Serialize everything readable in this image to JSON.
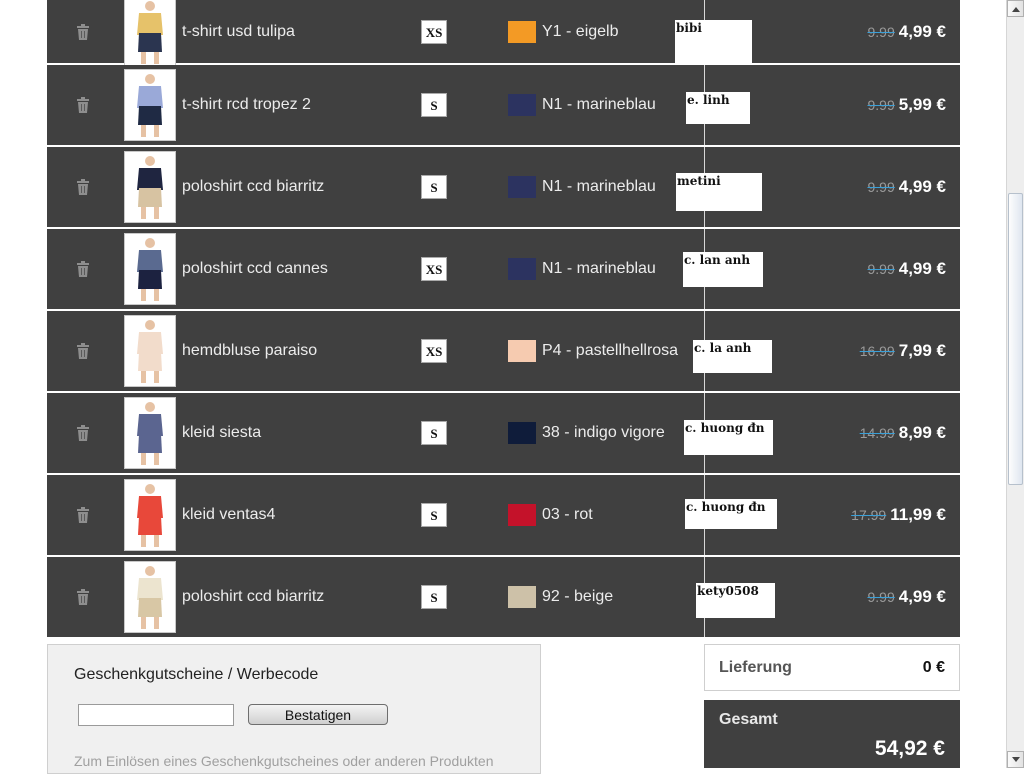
{
  "cart": {
    "items": [
      {
        "name": "t-shirt usd tulipa",
        "size": "XS",
        "color_name": "Y1 - eigelb",
        "color_hex": "#f39a25",
        "note": "bibi",
        "old_price": "9.99",
        "price": "4,99 €",
        "garment_colors": [
          "#e6c26a",
          "#2b3550"
        ]
      },
      {
        "name": "t-shirt rcd tropez 2",
        "size": "S",
        "color_name": "N1 - marineblau",
        "color_hex": "#2c3360",
        "note": "e. linh",
        "old_price": "9.99",
        "price": "5,99 €",
        "garment_colors": [
          "#9aa9d8",
          "#1f2a44"
        ]
      },
      {
        "name": "poloshirt ccd biarritz",
        "size": "S",
        "color_name": "N1 - marineblau",
        "color_hex": "#2c3360",
        "note": "metini",
        "old_price": "9.99",
        "price": "4,99 €",
        "garment_colors": [
          "#1f2540",
          "#d7c3a2"
        ]
      },
      {
        "name": "poloshirt ccd cannes",
        "size": "XS",
        "color_name": "N1 - marineblau",
        "color_hex": "#2c3360",
        "note": "c. lan anh",
        "old_price": "9.99",
        "price": "4,99 €",
        "garment_colors": [
          "#5a6a90",
          "#1c2240"
        ]
      },
      {
        "name": "hemdbluse paraiso",
        "size": "XS",
        "color_name": "P4 - pastellhellrosa",
        "color_hex": "#f6cbb0",
        "note": "c. la anh",
        "old_price": "16.99",
        "price": "7,99 €",
        "garment_colors": [
          "#f2dccb",
          "#f2dccb"
        ]
      },
      {
        "name": "kleid siesta",
        "size": "S",
        "color_name": "38 - indigo vigore",
        "color_hex": "#0f1c3a",
        "note": "c. huong đn",
        "old_price": "14.99",
        "price": "8,99 €",
        "garment_colors": [
          "#5b6590",
          "#5b6590"
        ]
      },
      {
        "name": "kleid ventas4",
        "size": "S",
        "color_name": "03 - rot",
        "color_hex": "#c4122a",
        "note": "c. huong đn",
        "old_price": "17.99",
        "price": "11,99 €",
        "garment_colors": [
          "#e8483a",
          "#e8483a"
        ]
      },
      {
        "name": "poloshirt ccd biarritz",
        "size": "S",
        "color_name": "92 - beige",
        "color_hex": "#cdc1a8",
        "note": "kety0508",
        "old_price": "9.99",
        "price": "4,99 €",
        "garment_colors": [
          "#ece4cf",
          "#d8c7a5"
        ]
      }
    ]
  },
  "voucher": {
    "title": "Geschenkgutscheine / Werbecode",
    "input_value": "",
    "button_label": "Bestatigen",
    "hint": "Zum Einlösen eines Geschenkgutscheines oder anderen Produkten"
  },
  "summary": {
    "delivery_label": "Lieferung",
    "delivery_value": "0 €",
    "total_label": "Gesamt",
    "total_value": "54,92 €"
  },
  "icons": {
    "delete": "trash-icon"
  }
}
